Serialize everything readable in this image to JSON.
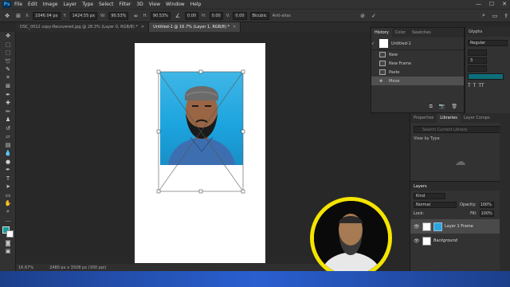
{
  "menu": {
    "logo": "Ps",
    "items": [
      "File",
      "Edit",
      "Image",
      "Layer",
      "Type",
      "Select",
      "Filter",
      "3D",
      "View",
      "Window",
      "Help"
    ]
  },
  "options": {
    "x_label": "X:",
    "x_value": "1046.04 px",
    "y_label": "Y:",
    "y_value": "1424.55 px",
    "w_label": "W:",
    "w_value": "90.53%",
    "h_label": "H:",
    "h_value": "90.53%",
    "angle_value": "0.00",
    "h2_label": "H:",
    "h2_value": "0.00",
    "v_label": "V:",
    "v_value": "0.00",
    "interp": "Bicubic",
    "antialias": "Anti-alias"
  },
  "tabs": [
    {
      "label": "DSC_0012 copy-Recovered.jpg @ 28.3% (Layer 0, RGB/8) *",
      "active": false
    },
    {
      "label": "Untitled-1 @ 16.7% (Layer 1, RGB/8) *",
      "active": true
    }
  ],
  "status": {
    "zoom": "16.67%",
    "doc": "2480 px x 3508 px (300 ppi)"
  },
  "history": {
    "tabs": [
      "History",
      "Color",
      "Swatches"
    ],
    "snapshot": "Untitled-1",
    "items": [
      "New",
      "New Frame",
      "Paste",
      "Move"
    ]
  },
  "glyphs": {
    "title": "Glyphs",
    "style": "Regular",
    "size": "3"
  },
  "props": {
    "tabs": [
      "Properties",
      "Libraries",
      "Layer Comps"
    ],
    "search_placeholder": "Search Current Library",
    "view_by": "View by Type"
  },
  "layers": {
    "title": "Layers",
    "kind": "Kind",
    "blend": "Normal",
    "opacity_label": "Opacity:",
    "opacity": "100%",
    "lock_label": "Lock:",
    "fill_label": "Fill:",
    "fill": "100%",
    "rows": [
      {
        "name": "Layer 1 Frame",
        "selected": true
      },
      {
        "name": "Background",
        "selected": false
      }
    ]
  },
  "colors": {
    "accent": "#31a8ff",
    "webcam_ring": "#f5e400",
    "photo_bg": "#1ba3de"
  }
}
